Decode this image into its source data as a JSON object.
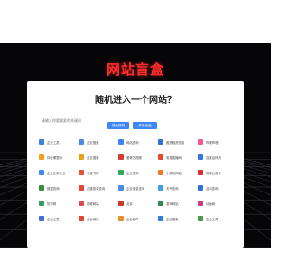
{
  "site_title": "网站盲盒",
  "question": "随机进入一个网站？",
  "search": {
    "placeholder": "请输入你要搜索的关键词"
  },
  "buttons": {
    "random": "搜索随机",
    "submit": "开始盲盒"
  },
  "sites": [
    {
      "label": "企业工具",
      "color": "#3f7fe0"
    },
    {
      "label": "企业搜索",
      "color": "#4a8be8"
    },
    {
      "label": "网站查询",
      "color": "#3d86f5"
    },
    {
      "label": "融资融资信息",
      "color": "#2f6fd6"
    },
    {
      "label": "哔哩哔哩",
      "color": "#f05a8a"
    },
    {
      "label": "你在哪里哦",
      "color": "#f0a020"
    },
    {
      "label": "企业搜索",
      "color": "#e8a01c"
    },
    {
      "label": "爱奇艺视频",
      "color": "#d93c2f"
    },
    {
      "label": "电视直播网",
      "color": "#e84a2e"
    },
    {
      "label": "百度百科内",
      "color": "#2f7ae0"
    },
    {
      "label": "企业之家企业",
      "color": "#3d8af0"
    },
    {
      "label": "小说书库",
      "color": "#ef4f3a"
    },
    {
      "label": "企业查询",
      "color": "#2ea85a"
    },
    {
      "label": "小游戏网站",
      "color": "#f07a2a"
    },
    {
      "label": "网易云音乐",
      "color": "#d9302c"
    },
    {
      "label": "数据查询",
      "color": "#3b8e3b"
    },
    {
      "label": "百度收录查询",
      "color": "#e8452f"
    },
    {
      "label": "企业信息查询",
      "color": "#4c8de8"
    },
    {
      "label": "天气查询",
      "color": "#3fa0e0"
    },
    {
      "label": "百科查询",
      "color": "#2f72d8"
    },
    {
      "label": "知识网",
      "color": "#2f9e5e"
    },
    {
      "label": "视频网站",
      "color": "#e04c4c"
    },
    {
      "label": "北京",
      "color": "#c8392f"
    },
    {
      "label": "游戏网站",
      "color": "#2f8a4e"
    },
    {
      "label": "动画网",
      "color": "#c93a7f"
    },
    {
      "label": "企业工具",
      "color": "#3f6ee0"
    },
    {
      "label": "企业网站",
      "color": "#e0452f"
    },
    {
      "label": "企业软件",
      "color": "#e8902f"
    },
    {
      "label": "企业搜索",
      "color": "#2f80d8"
    },
    {
      "label": "企业工具",
      "color": "#4a9a4a"
    }
  ]
}
